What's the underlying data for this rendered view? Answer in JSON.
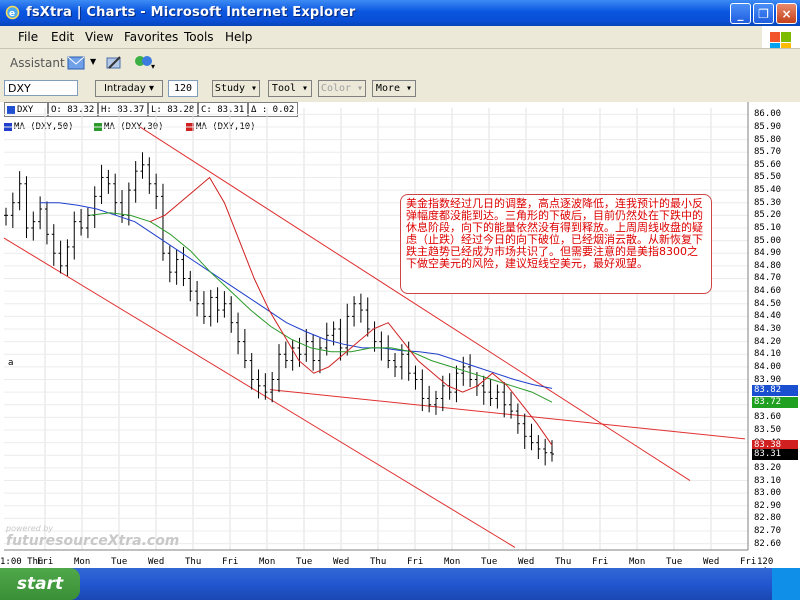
{
  "window": {
    "title": "fsXtra | Charts - Microsoft Internet Explorer",
    "minimize_glyph": "_",
    "restore_glyph": "❐",
    "close_glyph": "×"
  },
  "menu": [
    "File",
    "Edit",
    "View",
    "Favorites",
    "Tools",
    "Help"
  ],
  "assistant": {
    "label": "Assistant"
  },
  "toolbar": {
    "symbol": "DXY",
    "interval": "Intraday",
    "period": "120",
    "study": "Study",
    "tool": "Tool",
    "color": "Color",
    "more": "More"
  },
  "quote": {
    "symbol": "DXY",
    "open": "O: 83.32",
    "high": "H: 83.37",
    "low": "L: 83.28",
    "close": "C: 83.31",
    "change": "Δ : 0.02"
  },
  "legend": [
    {
      "label": "MA (DXY,50)",
      "color": "#1f3fcc"
    },
    {
      "label": "MA (DXY,30)",
      "color": "#2a9a2a"
    },
    {
      "label": "MA (DXY,10)",
      "color": "#d02020"
    }
  ],
  "annotation": "美金指数经过几日的调整，高点逐波降低，连我预计的最小反弹幅度都没能到达。三角形的下破后，目前仍然处在下跌中的休息阶段，向下的能量依然没有得到释放。上周周线收盘的疑虑（止跌）经过今日的向下破位，已经烟消云散。从新恢复下跌主趋势已经成为市场共识了。但需要注意的是美指8300之下做空美元的风险，建议短线空美元，最好观望。",
  "left_marker": "a",
  "watermark": "futuresourceXtra.com",
  "watermark_small": "powered by",
  "price_boxes": [
    {
      "value": "83.82",
      "color": "#1a4fd0"
    },
    {
      "value": "83.72",
      "color": "#20a020"
    },
    {
      "value": "83.38",
      "color": "#d02020"
    },
    {
      "value": "83.31",
      "color": "#000000"
    }
  ],
  "taskbar": {
    "start": "start"
  },
  "bottom_marker": "a",
  "chart_data": {
    "type": "candlestick",
    "yticks": [
      "86.00",
      "85.90",
      "85.80",
      "85.70",
      "85.60",
      "85.50",
      "85.40",
      "85.30",
      "85.20",
      "85.10",
      "85.00",
      "84.90",
      "84.80",
      "84.70",
      "84.60",
      "84.50",
      "84.40",
      "84.30",
      "84.20",
      "84.10",
      "84.00",
      "83.90",
      "83.80",
      "83.70",
      "83.60",
      "83.50",
      "83.40",
      "83.30",
      "83.20",
      "83.10",
      "83.00",
      "82.90",
      "82.80",
      "82.70",
      "82.60"
    ],
    "ylim": [
      82.55,
      86.05
    ],
    "xticks": [
      "1:00 Thu",
      "Fri",
      "Mon",
      "Tue",
      "Wed",
      "Thu",
      "Fri",
      "Mon",
      "Tue",
      "Wed",
      "Thu",
      "Fri",
      "Mon",
      "Tue",
      "Wed",
      "Thu",
      "Fri",
      "Mon",
      "Tue",
      "Wed",
      "Fri"
    ],
    "x_unit": "120 min.",
    "series": [
      {
        "name": "DXY",
        "values": [
          85.2,
          85.3,
          85.45,
          85.1,
          85.15,
          85.25,
          85.05,
          84.9,
          84.8,
          84.95,
          85.15,
          85.1,
          85.2,
          85.35,
          85.5,
          85.45,
          85.3,
          85.2,
          85.4,
          85.55,
          85.6,
          85.45,
          85.35,
          84.9,
          84.75,
          84.85,
          84.7,
          84.6,
          84.5,
          84.4,
          84.55,
          84.45,
          84.5,
          84.35,
          84.2,
          84.05,
          83.9,
          83.85,
          83.8,
          83.9,
          84.1,
          84.05,
          84.15,
          84.1,
          84.2,
          84.05,
          84.15,
          84.25,
          84.3,
          84.15,
          84.4,
          84.5,
          84.45,
          84.3,
          84.2,
          84.15,
          84.05,
          84.0,
          84.1,
          83.95,
          83.9,
          83.75,
          83.7,
          83.75,
          83.85,
          83.8,
          83.95,
          84.0,
          83.9,
          83.85,
          83.8,
          83.75,
          83.8,
          83.7,
          83.65,
          83.55,
          83.45,
          83.4,
          83.35,
          83.32,
          83.31
        ]
      },
      {
        "name": "MA (DXY,50)",
        "values": [
          85.3,
          85.3,
          85.28,
          85.25,
          85.2,
          85.15,
          85.05,
          84.95,
          84.85,
          84.75,
          84.65,
          84.55,
          84.45,
          84.35,
          84.28,
          84.22,
          84.18,
          84.15,
          84.15,
          84.13,
          84.12,
          84.1,
          84.05,
          84.0,
          83.95,
          83.9,
          83.86,
          83.83
        ]
      },
      {
        "name": "MA (DXY,30)",
        "values": [
          85.2,
          85.22,
          85.2,
          85.15,
          85.05,
          84.92,
          84.75,
          84.6,
          84.45,
          84.32,
          84.22,
          84.15,
          84.12,
          84.12,
          84.15,
          84.15,
          84.12,
          84.05,
          84.0,
          83.95,
          83.9,
          83.85,
          83.8,
          83.72
        ]
      },
      {
        "name": "MA (DXY,10)",
        "values": [
          85.15,
          85.2,
          85.3,
          85.4,
          85.5,
          85.3,
          85.0,
          84.7,
          84.45,
          84.25,
          84.05,
          83.95,
          84.0,
          84.1,
          84.2,
          84.3,
          84.35,
          84.2,
          84.05,
          83.95,
          83.85,
          83.8,
          83.85,
          83.95,
          83.85,
          83.7,
          83.55,
          83.38
        ]
      }
    ]
  }
}
